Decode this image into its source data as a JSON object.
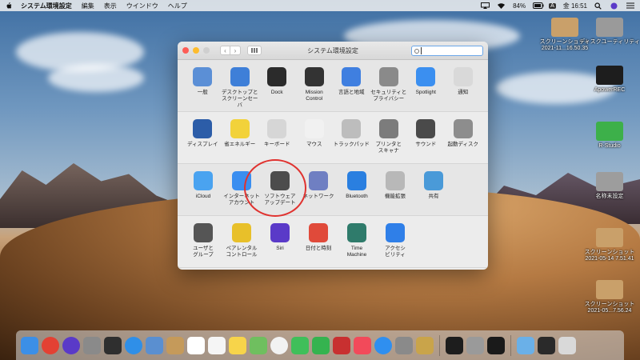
{
  "menubar": {
    "app_name": "システム環境設定",
    "items": [
      "編集",
      "表示",
      "ウインドウ",
      "ヘルプ"
    ],
    "battery": "84%",
    "input_source": "A",
    "clock": "金 16:51"
  },
  "window": {
    "title": "システム環境設定",
    "search_value": "",
    "sections": [
      [
        {
          "label": "一般",
          "icon": "general-icon",
          "color": "#5b8fd6"
        },
        {
          "label": "デスクトップと\nスクリーンセーバ",
          "icon": "desktop-icon",
          "color": "#3e7fd8"
        },
        {
          "label": "Dock",
          "icon": "dock-icon",
          "color": "#2b2b2b"
        },
        {
          "label": "Mission\nControl",
          "icon": "mission-control-icon",
          "color": "#333333"
        },
        {
          "label": "言語と地域",
          "icon": "language-icon",
          "color": "#3f7fe0"
        },
        {
          "label": "セキュリティと\nプライバシー",
          "icon": "security-icon",
          "color": "#8a8a8a"
        },
        {
          "label": "Spotlight",
          "icon": "spotlight-icon",
          "color": "#3b8ff0"
        },
        {
          "label": "通知",
          "icon": "notifications-icon",
          "color": "#d9d9d9"
        }
      ],
      [
        {
          "label": "ディスプレイ",
          "icon": "display-icon",
          "color": "#2c5da8"
        },
        {
          "label": "省エネルギー",
          "icon": "energy-saver-icon",
          "color": "#f2d23a"
        },
        {
          "label": "キーボード",
          "icon": "keyboard-icon",
          "color": "#d6d6d6"
        },
        {
          "label": "マウス",
          "icon": "mouse-icon",
          "color": "#f1f1f1"
        },
        {
          "label": "トラックパッド",
          "icon": "trackpad-icon",
          "color": "#bdbdbd"
        },
        {
          "label": "プリンタと\nスキャナ",
          "icon": "printer-icon",
          "color": "#7c7c7c"
        },
        {
          "label": "サウンド",
          "icon": "sound-icon",
          "color": "#4a4a4a"
        },
        {
          "label": "起動ディスク",
          "icon": "startup-disk-icon",
          "color": "#8d8d8d"
        }
      ],
      [
        {
          "label": "iCloud",
          "icon": "icloud-icon",
          "color": "#4aa3f0"
        },
        {
          "label": "インターネット\nアカウント",
          "icon": "internet-accounts-icon",
          "color": "#3a8ef0"
        },
        {
          "label": "ソフトウェア\nアップデート",
          "icon": "software-update-icon",
          "color": "#4c4c4c"
        },
        {
          "label": "ネットワーク",
          "icon": "network-icon",
          "color": "#6f7fc2"
        },
        {
          "label": "Bluetooth",
          "icon": "bluetooth-icon",
          "color": "#2a7fe0"
        },
        {
          "label": "機能拡張",
          "icon": "extensions-icon",
          "color": "#b8b8b8"
        },
        {
          "label": "共有",
          "icon": "sharing-icon",
          "color": "#4a9ad8"
        }
      ],
      [
        {
          "label": "ユーザと\nグループ",
          "icon": "users-groups-icon",
          "color": "#555555"
        },
        {
          "label": "ペアレンタル\nコントロール",
          "icon": "parental-controls-icon",
          "color": "#e8c02a"
        },
        {
          "label": "Siri",
          "icon": "siri-icon",
          "color": "#5a3ac8"
        },
        {
          "label": "日付と時刻",
          "icon": "date-time-icon",
          "color": "#e04a3a"
        },
        {
          "label": "Time\nMachine",
          "icon": "time-machine-icon",
          "color": "#2f7b6b"
        },
        {
          "label": "アクセシ\nビリティ",
          "icon": "accessibility-icon",
          "color": "#2f7fe8"
        }
      ]
    ]
  },
  "desktop": [
    {
      "label": "スクリーンショット\n2021-11...16.50.35",
      "icon": "screenshot-thumbnail-icon",
      "color": "#c9a06a"
    },
    {
      "label": "ディスクユーティリティ",
      "icon": "disk-utility-icon",
      "color": "#9a9a9a"
    },
    {
      "label": "ApowerREC",
      "icon": "apowerrec-icon",
      "color": "#1d1d1d"
    },
    {
      "label": "R-Studio",
      "icon": "r-studio-icon",
      "color": "#3db04a"
    },
    {
      "label": "名称未設定",
      "icon": "drive-icon",
      "color": "#9d9d9d"
    },
    {
      "label": "スクリーンショット\n2021-05-14 7.51.41",
      "icon": "screenshot-thumbnail-icon",
      "color": "#c9a06a"
    },
    {
      "label": "スクリーンショット\n2021-05...7.56.24",
      "icon": "screenshot-thumbnail-icon",
      "color": "#c9a06a"
    }
  ],
  "dock": [
    {
      "icon": "finder-icon",
      "color": "#3c8fe6"
    },
    {
      "icon": "chrome-icon",
      "color": "#e34133"
    },
    {
      "icon": "siri-icon",
      "color": "#5a3ac8"
    },
    {
      "icon": "launchpad-icon",
      "color": "#8a8a8a"
    },
    {
      "icon": "mission-control-icon",
      "color": "#2f2f2f"
    },
    {
      "icon": "safari-icon",
      "color": "#2f8fe8"
    },
    {
      "icon": "preview-icon",
      "color": "#5a8fd0"
    },
    {
      "icon": "contacts-icon",
      "color": "#c59a5a"
    },
    {
      "icon": "calendar-icon",
      "color": "#ffffff"
    },
    {
      "icon": "reminders-icon",
      "color": "#f5f5f5"
    },
    {
      "icon": "notes-icon",
      "color": "#f7d44a"
    },
    {
      "icon": "maps-icon",
      "color": "#6fbf5f"
    },
    {
      "icon": "photos-icon",
      "color": "#f2f2f2"
    },
    {
      "icon": "messages-icon",
      "color": "#3fbf5a"
    },
    {
      "icon": "facetime-icon",
      "color": "#35b34f"
    },
    {
      "icon": "photo-booth-icon",
      "color": "#c83030"
    },
    {
      "icon": "music-icon",
      "color": "#f24a5a"
    },
    {
      "icon": "app-store-icon",
      "color": "#2f8ff0"
    },
    {
      "icon": "system-preferences-icon",
      "color": "#8a8a8a"
    },
    {
      "icon": "archive-utility-icon",
      "color": "#c9a44a"
    },
    {
      "icon": "apowerrec-icon",
      "color": "#1d1d1d"
    },
    {
      "icon": "screenshot-tool-icon",
      "color": "#9a9a9a"
    },
    {
      "icon": "terminal-icon",
      "color": "#1a1a1a"
    },
    {
      "icon": "downloads-folder-icon",
      "color": "#6ab0e8"
    },
    {
      "icon": "screen-recorder-icon",
      "color": "#2a2a2a"
    },
    {
      "icon": "trash-icon",
      "color": "#d9d9d9"
    }
  ]
}
